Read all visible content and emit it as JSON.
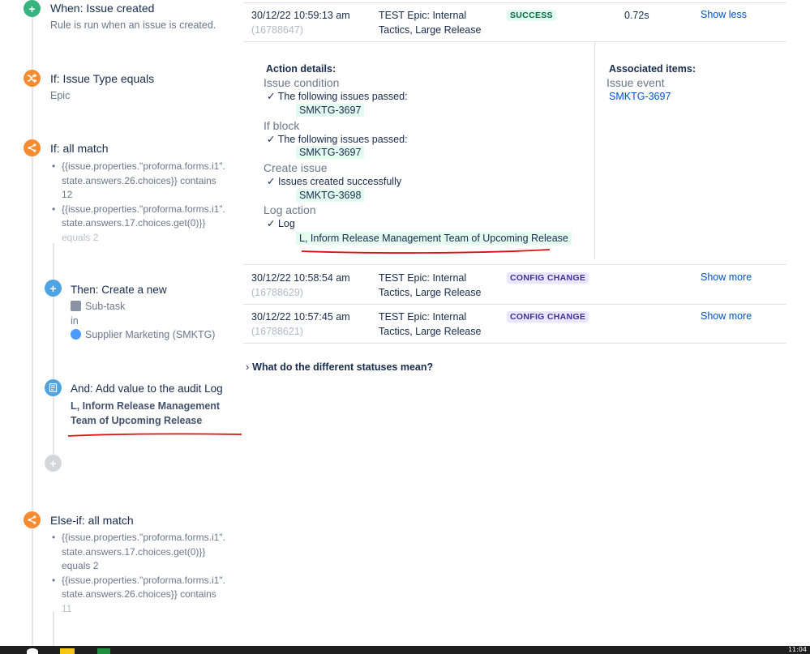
{
  "rule": {
    "trigger": {
      "title": "When: Issue created",
      "sub": "Rule is run when an issue is created."
    },
    "cond1": {
      "title": "If: Issue Type equals",
      "sub": "Epic"
    },
    "cond2": {
      "title": "If: all match",
      "bullets": [
        "{{issue.properties.\"proforma.forms.i1\".",
        "state.answers.26.choices}} contains",
        "12",
        "{{issue.properties.\"proforma.forms.i1\".",
        "state.answers.17.choices.get(0)}}",
        "equals 2"
      ]
    },
    "action1": {
      "title": "Then: Create a new",
      "type": "Sub-task",
      "in": "in",
      "project": "Supplier Marketing (SMKTG)"
    },
    "action2": {
      "title": "And: Add value to the audit Log",
      "log_line1": "L, Inform Release Management",
      "log_line2": "Team of Upcoming Release"
    },
    "elseif": {
      "title": "Else-if: all match",
      "bullets": [
        "{{issue.properties.\"proforma.forms.i1\".",
        "state.answers.17.choices.get(0)}}",
        "equals 2",
        "{{issue.properties.\"proforma.forms.i1\".",
        "state.answers.26.choices}} contains",
        "11"
      ]
    }
  },
  "audit": {
    "rows": [
      {
        "date": "30/12/22 10:59:13 am",
        "id": "(16788647)",
        "issue1": "TEST Epic: Internal",
        "issue2": "Tactics, Large Release",
        "status": "SUCCESS",
        "duration": "0.72s",
        "action": "Show less"
      },
      {
        "date": "30/12/22 10:58:54 am",
        "id": "(16788629)",
        "issue1": "TEST Epic: Internal",
        "issue2": "Tactics, Large Release",
        "status": "CONFIG CHANGE",
        "duration": "",
        "action": "Show more"
      },
      {
        "date": "30/12/22 10:57:45 am",
        "id": "(16788621)",
        "issue1": "TEST Epic: Internal",
        "issue2": "Tactics, Large Release",
        "status": "CONFIG CHANGE",
        "duration": "",
        "action": "Show more"
      }
    ],
    "details": {
      "action_head": "Action details:",
      "assoc_head": "Associated items:",
      "sections": [
        {
          "name": "Issue condition",
          "check": "The following issues passed:",
          "tag": "SMKTG-3697"
        },
        {
          "name": "If block",
          "check": "The following issues passed:",
          "tag": "SMKTG-3697"
        },
        {
          "name": "Create issue",
          "check": "Issues created successfully",
          "tag": "SMKTG-3698"
        },
        {
          "name": "Log action",
          "check": "Log",
          "tag": "L, Inform Release Management Team of Upcoming Release"
        }
      ],
      "assoc_label": "Issue event",
      "assoc_link": "SMKTG-3697"
    },
    "faq": "What do the different statuses mean?"
  },
  "taskbar": {
    "time": "11:04"
  },
  "colors": {
    "success_bg": "#e3fcef",
    "config_bg": "#eae6ff",
    "link": "#0052cc",
    "annotation": "#e01010"
  }
}
